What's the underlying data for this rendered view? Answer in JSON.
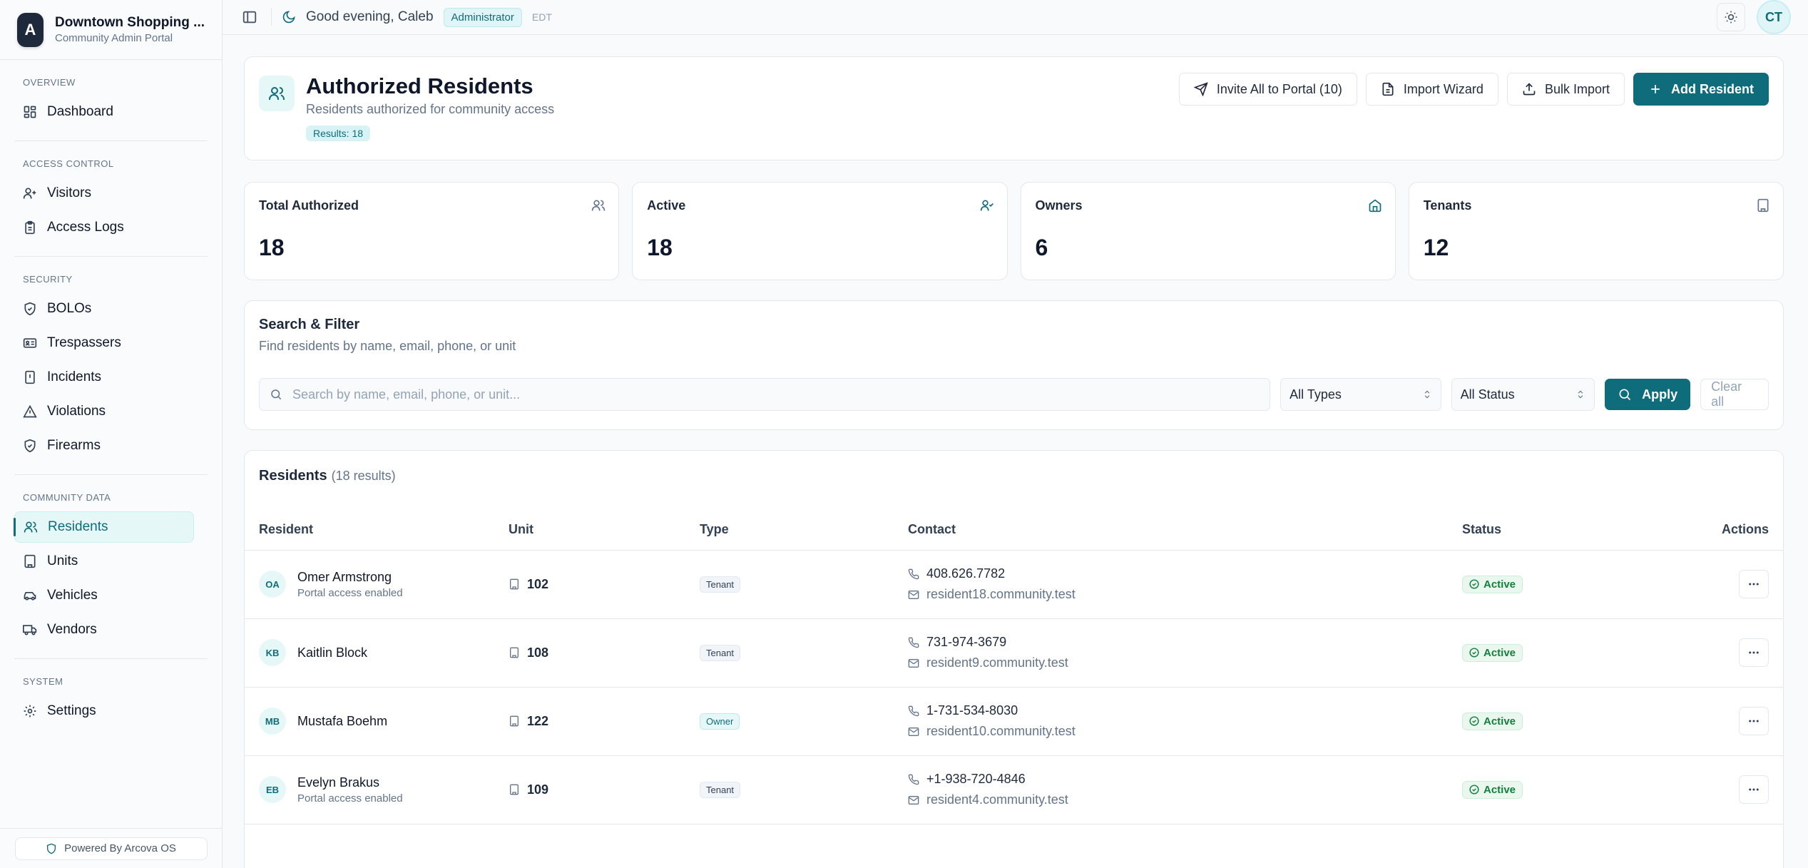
{
  "brand": {
    "logo_letter": "A",
    "name": "Downtown Shopping ...",
    "subtitle": "Community Admin Portal"
  },
  "sidebar": {
    "sections": [
      {
        "heading": "OVERVIEW",
        "items": [
          {
            "label": "Dashboard",
            "icon": "dashboard-icon"
          }
        ]
      },
      {
        "heading": "ACCESS CONTROL",
        "items": [
          {
            "label": "Visitors",
            "icon": "user-plus-icon"
          },
          {
            "label": "Access Logs",
            "icon": "clipboard-icon"
          }
        ]
      },
      {
        "heading": "SECURITY",
        "items": [
          {
            "label": "BOLOs",
            "icon": "shield-icon"
          },
          {
            "label": "Trespassers",
            "icon": "id-card-icon"
          },
          {
            "label": "Incidents",
            "icon": "alert-file-icon"
          },
          {
            "label": "Violations",
            "icon": "warning-icon"
          },
          {
            "label": "Firearms",
            "icon": "shield-check-icon"
          }
        ]
      },
      {
        "heading": "COMMUNITY DATA",
        "items": [
          {
            "label": "Residents",
            "icon": "users-icon",
            "active": true
          },
          {
            "label": "Units",
            "icon": "building-icon"
          },
          {
            "label": "Vehicles",
            "icon": "car-icon"
          },
          {
            "label": "Vendors",
            "icon": "truck-icon"
          }
        ]
      },
      {
        "heading": "SYSTEM",
        "items": [
          {
            "label": "Settings",
            "icon": "gear-icon"
          }
        ]
      }
    ],
    "footer": "Powered By Arcova OS"
  },
  "topbar": {
    "greeting": "Good evening, Caleb",
    "role": "Administrator",
    "timezone": "EDT",
    "avatar_initials": "CT"
  },
  "page": {
    "title": "Authorized Residents",
    "subtitle": "Residents authorized for community access",
    "results_badge": "Results: 18",
    "actions": {
      "invite": "Invite All to Portal (10)",
      "import_wizard": "Import Wizard",
      "bulk_import": "Bulk Import",
      "add": "Add Resident"
    }
  },
  "stats": [
    {
      "label": "Total Authorized",
      "value": "18",
      "icon": "users-icon"
    },
    {
      "label": "Active",
      "value": "18",
      "icon": "user-check-icon"
    },
    {
      "label": "Owners",
      "value": "6",
      "icon": "home-icon"
    },
    {
      "label": "Tenants",
      "value": "12",
      "icon": "building-icon"
    }
  ],
  "filter": {
    "title": "Search & Filter",
    "subtitle": "Find residents by name, email, phone, or unit",
    "search_placeholder": "Search by name, email, phone, or unit...",
    "type_select": "All Types",
    "status_select": "All Status",
    "apply": "Apply",
    "clear": "Clear all"
  },
  "table": {
    "title": "Residents",
    "count": "(18 results)",
    "columns": {
      "resident": "Resident",
      "unit": "Unit",
      "type": "Type",
      "contact": "Contact",
      "status": "Status",
      "actions": "Actions"
    },
    "rows": [
      {
        "initials": "OA",
        "name": "Omer Armstrong",
        "sub": "Portal access enabled",
        "unit": "102",
        "type": "Tenant",
        "phone": "408.626.7782",
        "email": "resident18.community.test",
        "status": "Active"
      },
      {
        "initials": "KB",
        "name": "Kaitlin Block",
        "sub": "",
        "unit": "108",
        "type": "Tenant",
        "phone": "731-974-3679",
        "email": "resident9.community.test",
        "status": "Active"
      },
      {
        "initials": "MB",
        "name": "Mustafa Boehm",
        "sub": "",
        "unit": "122",
        "type": "Owner",
        "phone": "1-731-534-8030",
        "email": "resident10.community.test",
        "status": "Active"
      },
      {
        "initials": "EB",
        "name": "Evelyn Brakus",
        "sub": "Portal access enabled",
        "unit": "109",
        "type": "Tenant",
        "phone": "+1-938-720-4846",
        "email": "resident4.community.test",
        "status": "Active"
      }
    ]
  }
}
